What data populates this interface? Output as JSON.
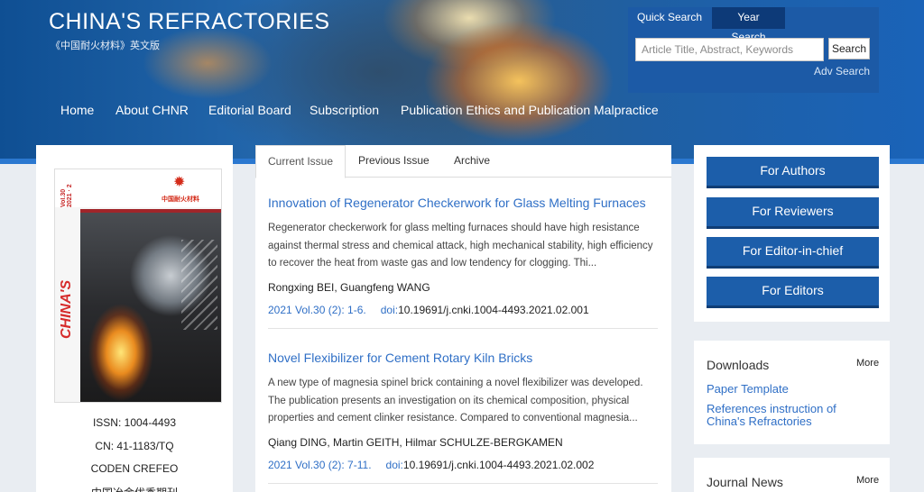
{
  "header": {
    "title": "CHINA'S REFRACTORIES",
    "subtitle": "《中国耐火材料》英文版"
  },
  "search": {
    "quick_tab": "Quick Search",
    "year_tab": "Year Search",
    "placeholder": "Article Title, Abstract, Keywords",
    "button": "Search",
    "advanced": "Adv Search"
  },
  "nav": {
    "items": [
      "Home",
      "About CHNR",
      "Editorial Board",
      "Subscription",
      "Publication Ethics and Publication Malpractice"
    ]
  },
  "journal": {
    "cover": {
      "year": "Vol.30 2021 · 2",
      "logo_text": "中国耐火材料",
      "vertical_title": "CHINA'S REFRACTORIES"
    },
    "issn": "ISSN: 1004-4493",
    "cn": "CN: 41-1183/TQ",
    "coden": "CODEN CREFEO",
    "extra": "中国冶金优秀期刊"
  },
  "tabs": [
    "Current Issue",
    "Previous Issue",
    "Archive"
  ],
  "articles": [
    {
      "title": "Innovation of Regenerator Checkerwork for Glass Melting Furnaces",
      "abstract": "Regenerator checkerwork for glass melting furnaces should have high resistance against thermal stress and chemical attack, high mechanical stability, high efficiency to recover the heat from waste gas and low tendency for clogging. Thi...",
      "authors": "Rongxing BEI, Guangfeng WANG",
      "volume": "2021 Vol.30 (2): 1-6.",
      "doi_label": "doi:",
      "doi": "10.19691/j.cnki.1004-4493.2021.02.001"
    },
    {
      "title": "Novel Flexibilizer for Cement Rotary Kiln Bricks",
      "abstract": "A new type of magnesia spinel brick containing a novel flexibilizer was developed. The publication presents an investigation on its chemical composition, physical properties and cement clinker resistance. Compared to conventional magnesia...",
      "authors": "Qiang DING, Martin GEITH, Hilmar SCHULZE-BERGKAMEN",
      "volume": "2021 Vol.30 (2): 7-11.",
      "doi_label": "doi:",
      "doi": "10.19691/j.cnki.1004-4493.2021.02.002"
    }
  ],
  "roles": [
    "For Authors",
    "For Reviewers",
    "For Editor-in-chief",
    "For Editors"
  ],
  "downloads": {
    "title": "Downloads",
    "more": "More",
    "links": [
      "Paper Template",
      "References instruction of China's Refractories"
    ]
  },
  "news": {
    "title": "Journal News",
    "more": "More"
  },
  "colors": {
    "primary": "#1c5eaa",
    "link": "#2f6fc6",
    "background": "#e9edf2"
  }
}
